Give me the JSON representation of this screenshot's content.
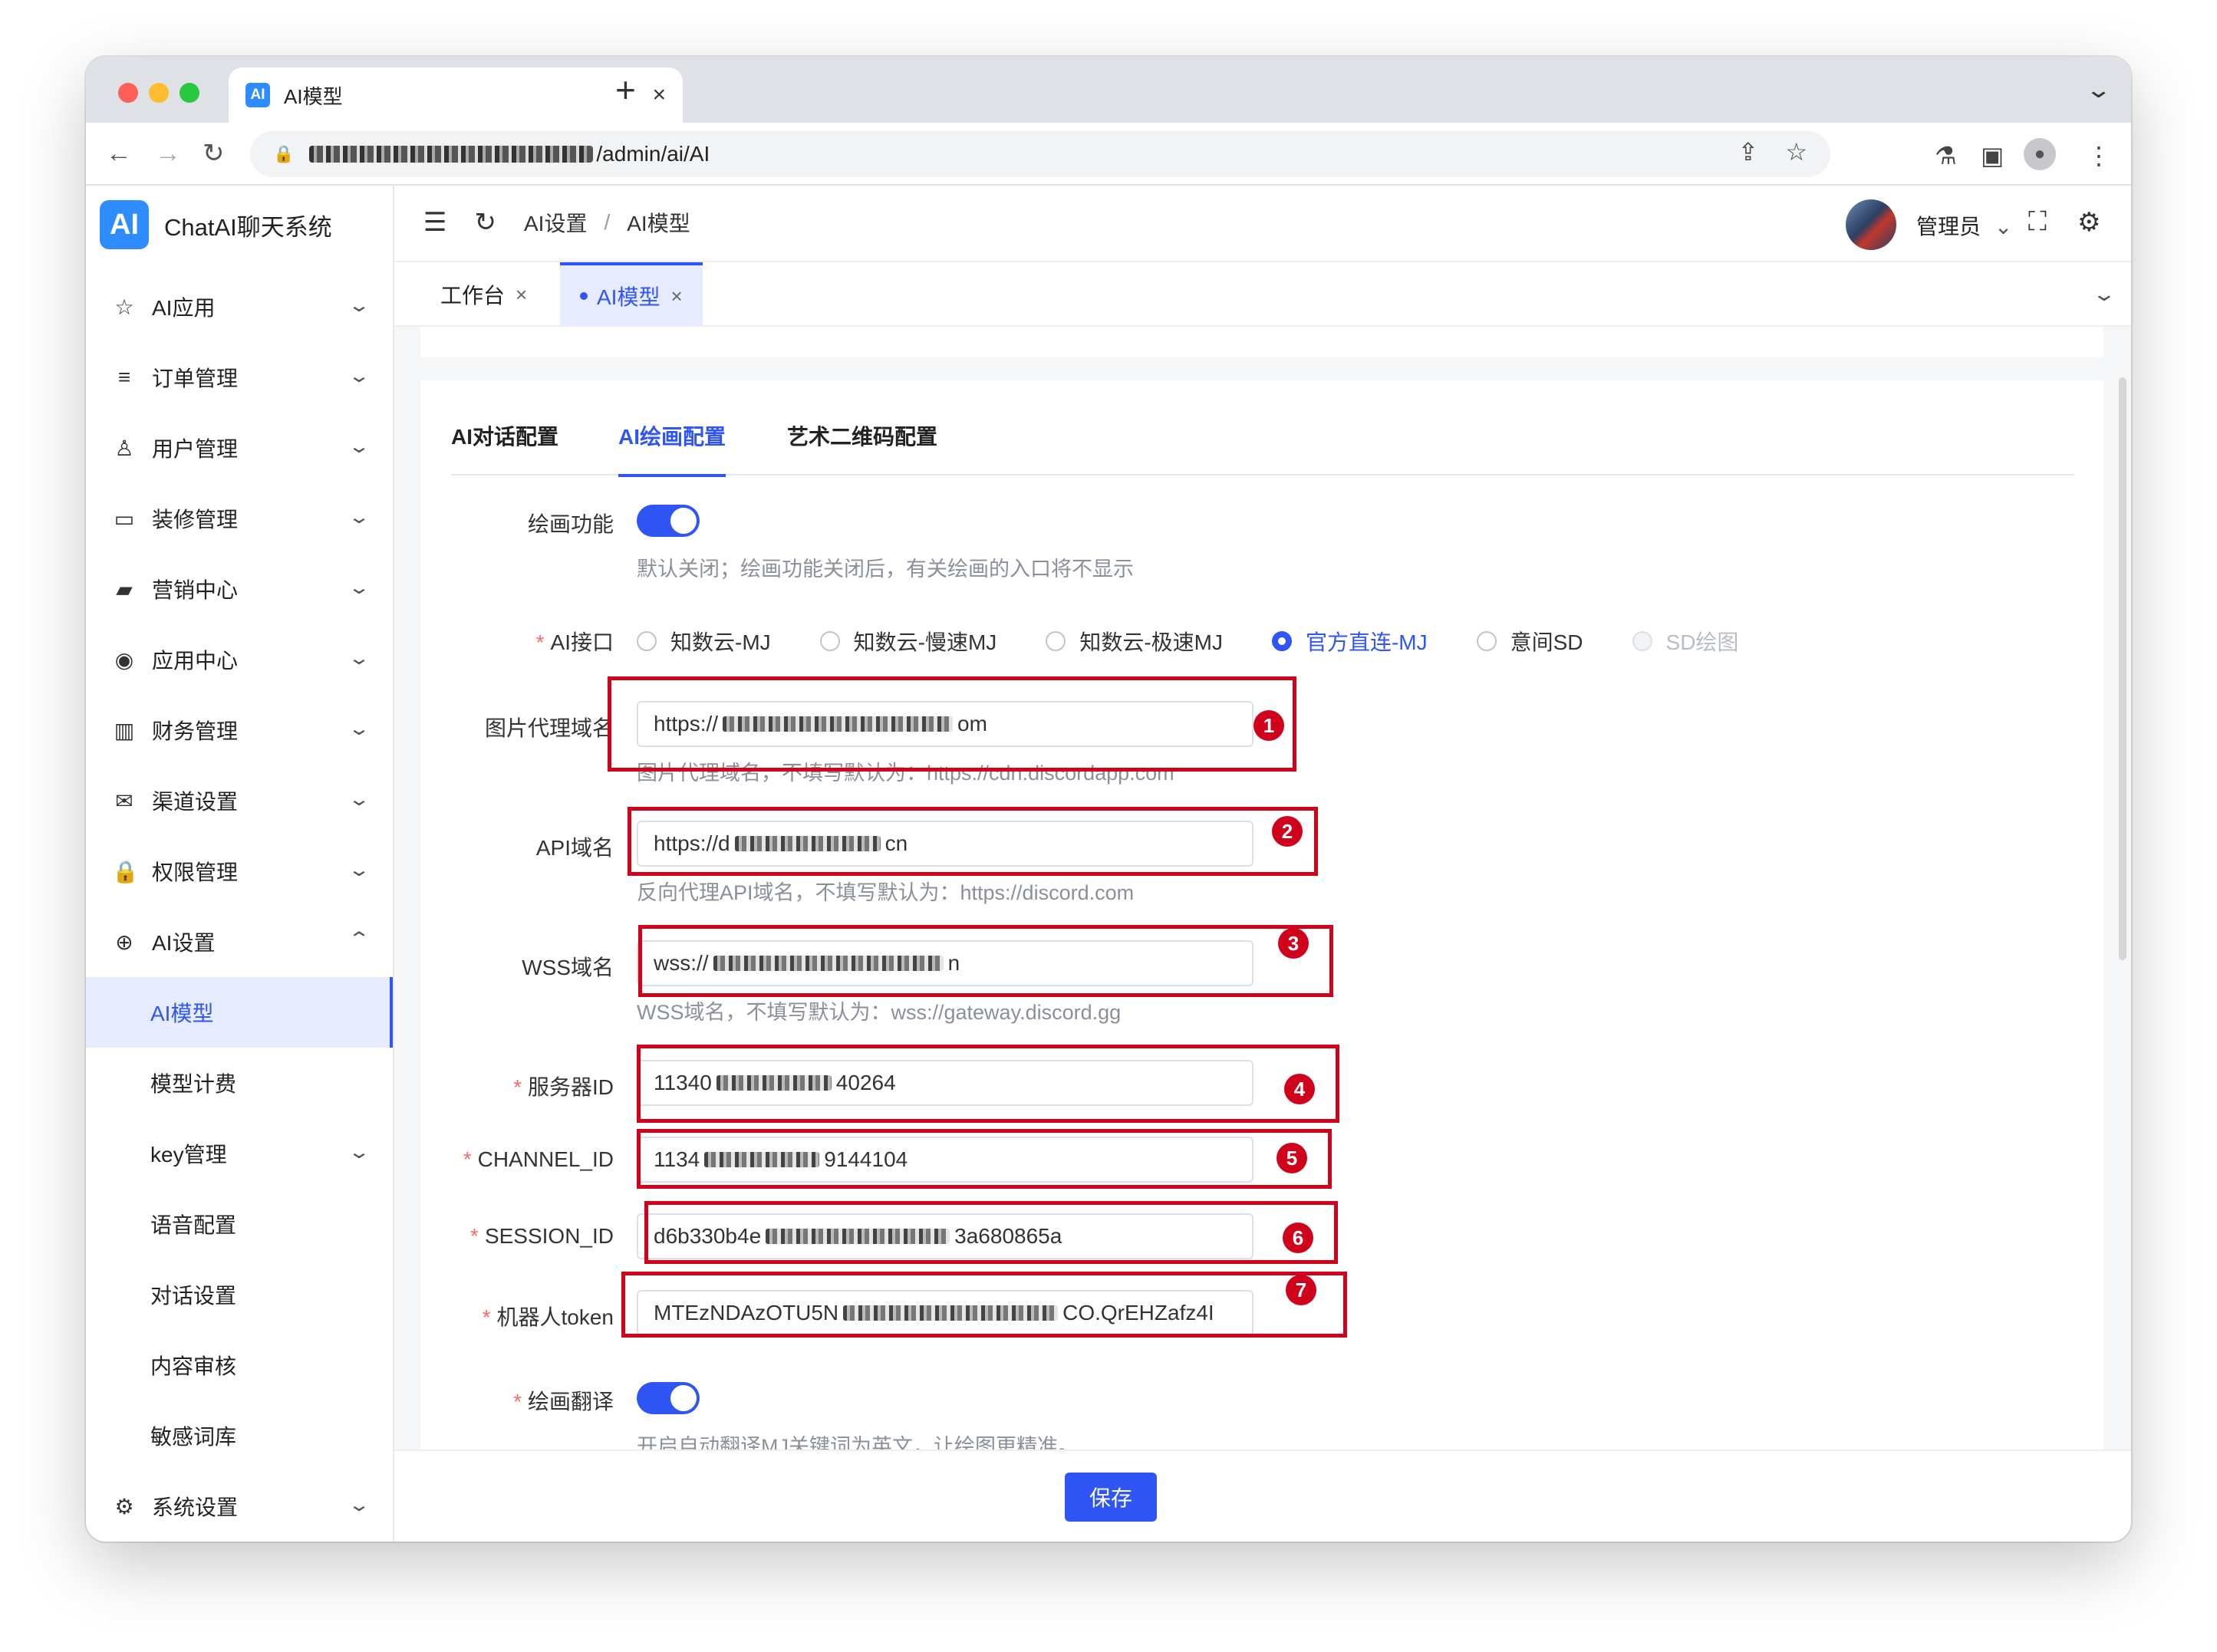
{
  "browser": {
    "tab_title": "AI模型",
    "favicon_text": "AI",
    "url_path": "/admin/ai/AI"
  },
  "brand": {
    "logo": "AI",
    "name": "ChatAI聊天系统"
  },
  "sidebar": {
    "items": [
      {
        "label": "AI应用",
        "icon": "☆"
      },
      {
        "label": "订单管理",
        "icon": "≡"
      },
      {
        "label": "用户管理",
        "icon": "♙"
      },
      {
        "label": "装修管理",
        "icon": "▭"
      },
      {
        "label": "营销中心",
        "icon": "▰"
      },
      {
        "label": "应用中心",
        "icon": "◉"
      },
      {
        "label": "财务管理",
        "icon": "▥"
      },
      {
        "label": "渠道设置",
        "icon": "✉"
      },
      {
        "label": "权限管理",
        "icon": "🔒"
      },
      {
        "label": "AI设置",
        "icon": "⊕"
      }
    ],
    "sub_items": [
      {
        "label": "AI模型"
      },
      {
        "label": "模型计费"
      },
      {
        "label": "key管理"
      },
      {
        "label": "语音配置"
      },
      {
        "label": "对话设置"
      },
      {
        "label": "内容审核"
      },
      {
        "label": "敏感词库"
      }
    ],
    "system": {
      "label": "系统设置",
      "icon": "⚙"
    }
  },
  "header": {
    "breadcrumb": [
      "AI设置",
      "AI模型"
    ],
    "user": "管理员"
  },
  "tags": [
    {
      "label": "工作台"
    },
    {
      "label": "AI模型"
    }
  ],
  "subtabs": [
    "AI对话配置",
    "AI绘画配置",
    "艺术二维码配置"
  ],
  "form": {
    "draw_enable": {
      "label": "绘画功能",
      "help": "默认关闭；绘画功能关闭后，有关绘画的入口将不显示",
      "on": true
    },
    "api_iface": {
      "label": "AI接口",
      "options": [
        "知数云-MJ",
        "知数云-慢速MJ",
        "知数云-极速MJ",
        "官方直连-MJ",
        "意间SD",
        "SD绘图"
      ],
      "selected": "官方直连-MJ"
    },
    "proxy_domain": {
      "label": "图片代理域名",
      "prefix": "https://",
      "suffix": "om",
      "help": "图片代理域名，不填写默认为：https://cdn.discordapp.com"
    },
    "api_domain": {
      "label": "API域名",
      "prefix": "https://d",
      "suffix": "cn",
      "help": "反向代理API域名，不填写默认为：https://discord.com"
    },
    "wss_domain": {
      "label": "WSS域名",
      "prefix": "wss://",
      "suffix": "n",
      "help": "WSS域名，不填写默认为：wss://gateway.discord.gg"
    },
    "server_id": {
      "label": "服务器ID",
      "prefix": "11340",
      "suffix": "40264"
    },
    "channel_id": {
      "label": "CHANNEL_ID",
      "prefix": "1134",
      "suffix": "9144104"
    },
    "session_id": {
      "label": "SESSION_ID",
      "prefix": "d6b330b4e",
      "suffix": "3a680865a"
    },
    "bot_token": {
      "label": "机器人token",
      "prefix": "MTEzNDAzOTU5N",
      "suffix": "CO.QrEHZafz4I"
    },
    "draw_translate": {
      "label": "绘画翻译",
      "help": "开启自动翻译MJ关键词为英文，让绘图更精准。",
      "on": true
    }
  },
  "badges": [
    "1",
    "2",
    "3",
    "4",
    "5",
    "6",
    "7"
  ],
  "save_label": "保存"
}
